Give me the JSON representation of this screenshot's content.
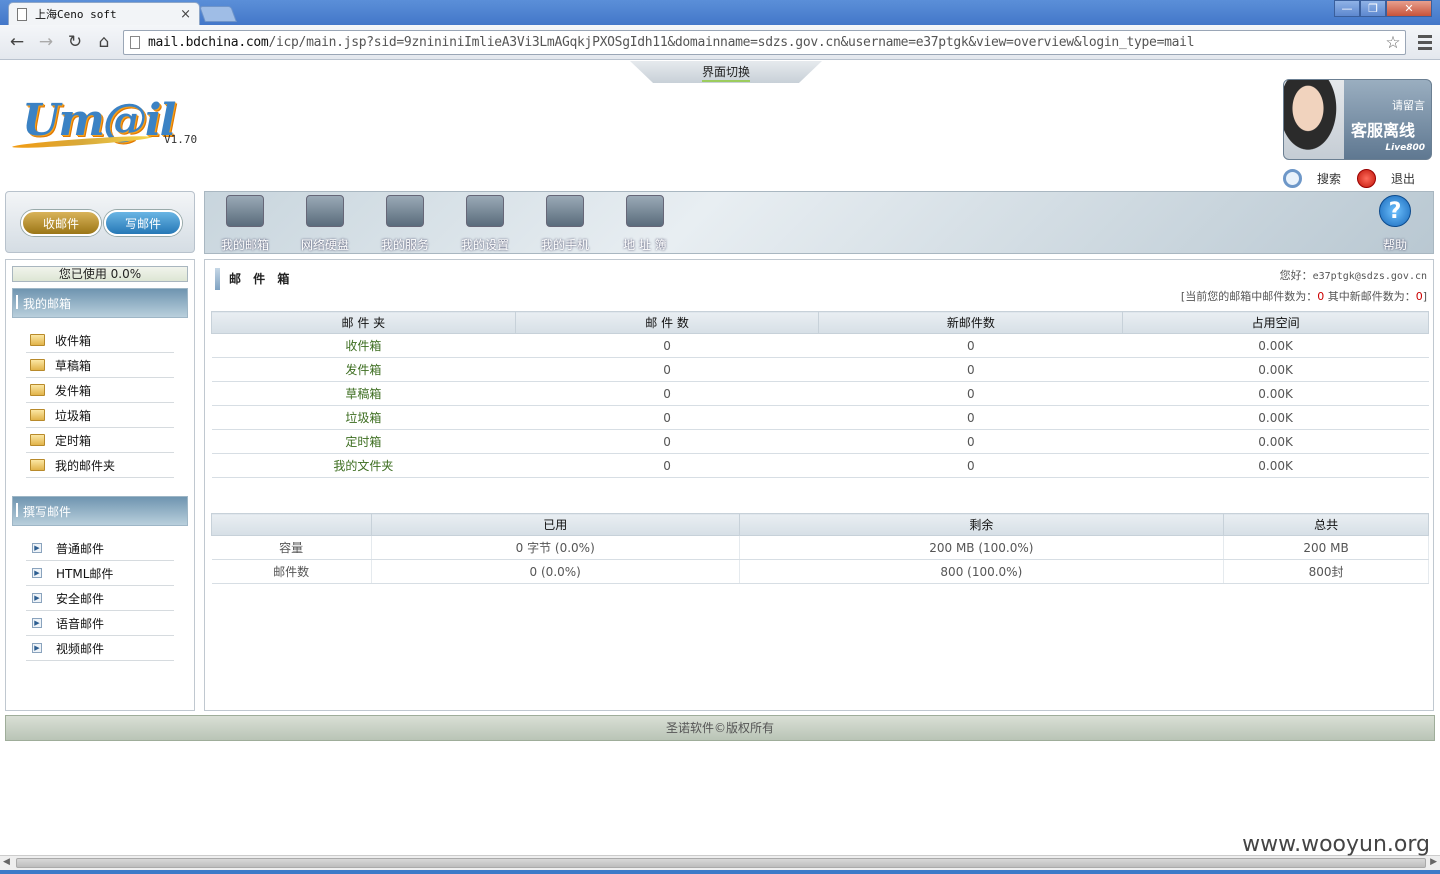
{
  "browser": {
    "tab_title": "上海Ceno soft",
    "tab_close": "×",
    "url_host": "mail.bdchina.com",
    "url_path": "/icp/main.jsp?sid=9znininiImlieA3Vi3LmAGqkjPXOSgIdh11&domainname=sdzs.gov.cn&username=e37ptgk&view=overview&login_type=mail",
    "back": "←",
    "forward": "→",
    "reload": "↻",
    "home": "⌂",
    "star": "☆",
    "win_min": "—",
    "win_max": "❐",
    "win_close": "✕"
  },
  "header": {
    "switch_label": "界面切换",
    "logo_text": "Um@il",
    "version": "V1.70",
    "live": {
      "line1": "请留言",
      "line2": "客服离线",
      "line3": "Live800"
    },
    "search_label": "搜索",
    "logout_label": "退出"
  },
  "buttons": {
    "receive": "收邮件",
    "write": "写邮件"
  },
  "nav": [
    {
      "label": "我的邮箱"
    },
    {
      "label": "网络硬盘"
    },
    {
      "label": "我的服务"
    },
    {
      "label": "我的设置"
    },
    {
      "label": "我的手机"
    },
    {
      "label": "地 址 簿"
    }
  ],
  "help": {
    "label": "帮助",
    "glyph": "?"
  },
  "sidebar": {
    "usage": "您已使用 0.0%",
    "mailbox_title": "我的邮箱",
    "mailbox_items": [
      "收件箱",
      "草稿箱",
      "发件箱",
      "垃圾箱",
      "定时箱",
      "我的邮件夹"
    ],
    "compose_title": "撰写邮件",
    "compose_items": [
      "普通邮件",
      "HTML邮件",
      "安全邮件",
      "语音邮件",
      "视频邮件"
    ]
  },
  "main": {
    "title": "邮 件 箱",
    "greeting_prefix": "您好：",
    "greeting_user": "e37ptgk@sdzs.gov.cn",
    "summary_prefix": "[当前您的邮箱中邮件数为：",
    "summary_total": "0",
    "summary_mid": " 其中新邮件数为：",
    "summary_new": "0",
    "summary_suffix": "]",
    "folder_headers": [
      "邮 件 夹",
      "邮 件 数",
      "新邮件数",
      "占用空间"
    ],
    "folders": [
      [
        "收件箱",
        "0",
        "0",
        "0.00K"
      ],
      [
        "发件箱",
        "0",
        "0",
        "0.00K"
      ],
      [
        "草稿箱",
        "0",
        "0",
        "0.00K"
      ],
      [
        "垃圾箱",
        "0",
        "0",
        "0.00K"
      ],
      [
        "定时箱",
        "0",
        "0",
        "0.00K"
      ],
      [
        "我的文件夹",
        "0",
        "0",
        "0.00K"
      ]
    ],
    "quota_headers": [
      "",
      "已用",
      "剩余",
      "总共"
    ],
    "quota": [
      [
        "容量",
        "0 字节 (0.0%)",
        "200 MB (100.0%)",
        "200 MB"
      ],
      [
        "邮件数",
        "0 (0.0%)",
        "800 (100.0%)",
        "800封"
      ]
    ]
  },
  "footer": "圣诺软件©版权所有",
  "watermark": "www.wooyun.org"
}
